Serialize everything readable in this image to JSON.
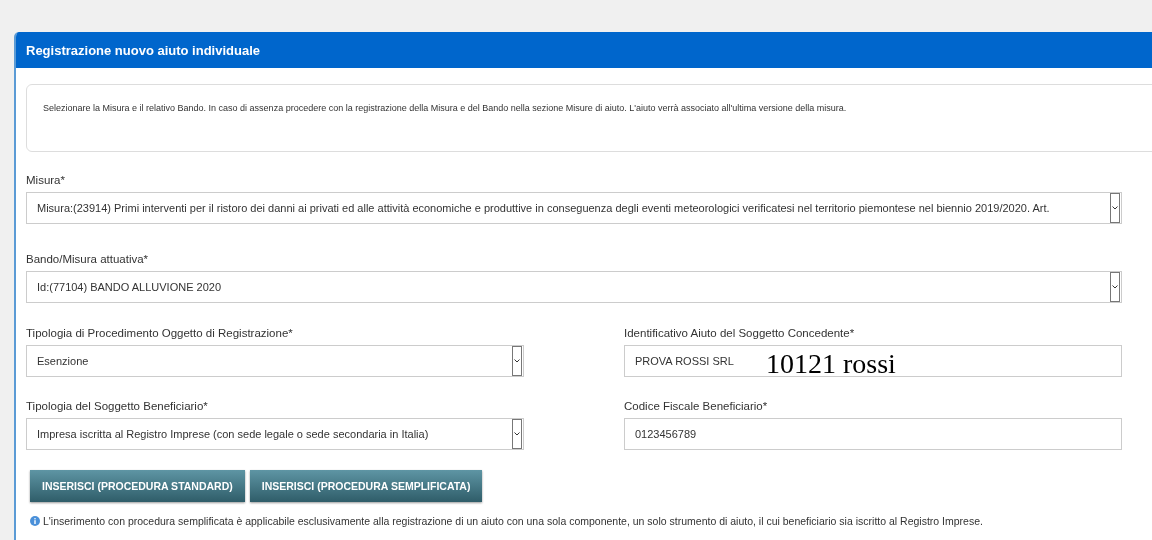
{
  "panel": {
    "title": "Registrazione nuovo aiuto individuale"
  },
  "notice": "Selezionare la Misura e il relativo Bando. In caso di assenza procedere con la registrazione della Misura e del Bando nella sezione Misure di aiuto. L'aiuto verrà associato all'ultima versione della misura.",
  "full_fields": [
    {
      "label": "Misura*",
      "kind": "select",
      "value": "Misura:(23914) Primi interventi per il ristoro dei danni ai privati ed alle attività economiche e produttive in conseguenza degli eventi meteorologici verificatesi nel territorio piemontese nel biennio 2019/2020. Art."
    },
    {
      "label": "Bando/Misura attuativa*",
      "kind": "select",
      "value": "Id:(77104) BANDO ALLUVIONE 2020"
    }
  ],
  "grid_fields": [
    {
      "label": "Tipologia di Procedimento Oggetto di Registrazione*",
      "kind": "select",
      "value": "Esenzione"
    },
    {
      "label": "Identificativo Aiuto del Soggetto Concedente*",
      "kind": "input",
      "value": "PROVA ROSSI SRL"
    },
    {
      "label": "Tipologia del Soggetto Beneficiario*",
      "kind": "select",
      "value": "Impresa iscritta al Registro Imprese (con sede legale o sede secondaria in Italia)"
    },
    {
      "label": "Codice Fiscale Beneficiario*",
      "kind": "input",
      "value": "0123456789"
    }
  ],
  "buttons": [
    "INSERISCI (PROCEDURA STANDARD)",
    "INSERISCI (PROCEDURA SEMPLIFICATA)"
  ],
  "info_note": "L'inserimento con procedura semplificata è applicabile esclusivamente alla registrazione di un aiuto con una sola componente, un solo strumento di aiuto, il cui beneficiario sia iscritto al Registro Imprese.",
  "overlay_text": "10121 rossi"
}
